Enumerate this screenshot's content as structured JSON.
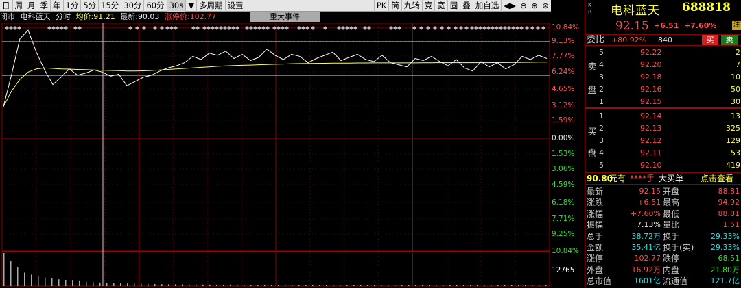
{
  "toolbar": {
    "left_items": [
      "日",
      "周",
      "月",
      "季",
      "年",
      "1分",
      "5分",
      "15分",
      "30分",
      "60分",
      "30s",
      "▼",
      "多周期",
      "设置"
    ],
    "active_index": 10,
    "right_items": [
      "PK",
      "简",
      "九转",
      "竞",
      "宽",
      "固",
      "叠",
      "加自选",
      "◀▶"
    ],
    "win_buttons": [
      "⊖",
      "⊕",
      "⊗"
    ]
  },
  "infobar": {
    "status": "闭市",
    "name": "电科蓝天",
    "mode": "分时",
    "avg_label": "均价:",
    "avg_value": "91.21",
    "last_label": "最新:",
    "last_value": "90.03",
    "limit_label": "涨停价:",
    "limit_value": "102.77",
    "event_button": "重大事件"
  },
  "axis": {
    "upper": [
      "10.84%",
      "9.13%",
      "7.77%",
      "6.24%",
      "4.65%",
      "3.12%",
      "1.59%",
      "0.00%",
      "1.53%",
      "3.06%",
      "4.59%",
      "6.18%",
      "7.71%",
      "9.25%",
      "10.84%"
    ],
    "volume_top": "12765"
  },
  "chart_data": {
    "type": "line",
    "series": [
      {
        "values": [
          3.0,
          6.1,
          9.5,
          10.3,
          8.2,
          6.5,
          5.1,
          5.8,
          6.6,
          6.0,
          6.2,
          6.5,
          6.3,
          5.9,
          6.1,
          5.0,
          5.4,
          5.8,
          6.0,
          6.4,
          6.7,
          6.9,
          7.2,
          7.8,
          7.5,
          8.1,
          7.9,
          8.3,
          7.6,
          8.0,
          7.4,
          7.7,
          8.5,
          7.9,
          7.5,
          8.0,
          7.8,
          7.2,
          7.6,
          7.9,
          8.2,
          7.4,
          7.7,
          8.0,
          7.5,
          7.3,
          7.9,
          7.2,
          7.0,
          6.8,
          7.6,
          7.4,
          7.8,
          7.3,
          6.9,
          7.5,
          6.7,
          6.4,
          7.3,
          6.8,
          7.2,
          6.6,
          7.0,
          7.8,
          7.5,
          7.9,
          7.6
        ]
      },
      {
        "values": [
          3.0,
          4.5,
          5.6,
          6.3,
          6.6,
          6.7,
          6.65,
          6.6,
          6.58,
          6.55,
          6.53,
          6.5,
          6.48,
          6.45,
          6.43,
          6.4,
          6.4,
          6.42,
          6.45,
          6.5,
          6.55,
          6.6,
          6.65,
          6.7,
          6.75,
          6.8,
          6.85,
          6.9,
          6.92,
          6.95,
          6.97,
          7.0,
          7.02,
          7.05,
          7.07,
          7.1,
          7.11,
          7.12,
          7.13,
          7.14,
          7.15,
          7.16,
          7.16,
          7.17,
          7.17,
          7.18,
          7.18,
          7.18,
          7.18,
          7.18,
          7.18,
          7.19,
          7.19,
          7.2,
          7.2,
          7.2,
          7.2,
          7.2,
          7.2,
          7.2,
          7.21,
          7.21,
          7.22,
          7.23,
          7.24,
          7.25,
          7.26
        ]
      }
    ],
    "ylim": [
      -10.84,
      10.84
    ],
    "volume": [
      12765,
      9600,
      7200,
      5200,
      4400,
      3800,
      3300,
      2900,
      2600,
      2300,
      2100,
      1900,
      1700,
      1500,
      1400,
      1300,
      1200,
      1100,
      1000,
      950,
      900,
      850,
      800,
      760,
      720,
      690,
      660,
      640,
      620,
      600,
      590,
      580,
      570,
      560,
      550,
      540,
      530,
      520,
      510,
      500,
      495,
      490,
      485,
      480,
      475,
      470,
      465,
      460,
      455,
      450,
      445,
      440,
      435,
      430,
      425,
      420,
      415,
      410,
      405,
      400,
      395,
      390,
      385,
      380,
      376,
      372,
      368,
      364,
      360,
      356,
      352,
      348,
      344,
      340,
      336,
      332,
      328,
      324,
      320,
      316
    ]
  },
  "quote": {
    "kr": [
      "K",
      "R"
    ],
    "name": "电科蓝天",
    "code": "688818",
    "price": "92.15",
    "change": "+6.51",
    "pct": "+7.60%",
    "badge": "注",
    "weibi_label": "委比",
    "weibi_pct": "+80.92%",
    "weibi_vol": "840",
    "buy_label": "买",
    "sell_label": "卖",
    "sell_side": [
      "卖",
      "盘"
    ],
    "buy_side": [
      "买",
      "盘"
    ],
    "asks": [
      {
        "lvl": "5",
        "price": "92.22",
        "vol": "2"
      },
      {
        "lvl": "4",
        "price": "92.20",
        "vol": "7"
      },
      {
        "lvl": "3",
        "price": "92.18",
        "vol": "10"
      },
      {
        "lvl": "2",
        "price": "92.16",
        "vol": "50"
      },
      {
        "lvl": "1",
        "price": "92.15",
        "vol": "30"
      }
    ],
    "bids": [
      {
        "lvl": "1",
        "price": "92.14",
        "vol": "13"
      },
      {
        "lvl": "2",
        "price": "92.13",
        "vol": "325"
      },
      {
        "lvl": "3",
        "price": "92.12",
        "vol": "129"
      },
      {
        "lvl": "4",
        "price": "92.11",
        "vol": "53"
      },
      {
        "lvl": "5",
        "price": "92.10",
        "vol": "419"
      }
    ],
    "big_order": {
      "price": "90.80",
      "unit": "元有",
      "qty": "****手",
      "tag": "大买单",
      "link": "点击查看"
    },
    "stats": [
      {
        "l1": "最新",
        "v1": "92.15",
        "c1": "c-red",
        "l2": "开盘",
        "v2": "88.81",
        "c2": "c-red"
      },
      {
        "l1": "涨跌",
        "v1": "+6.51",
        "c1": "c-red",
        "l2": "最高",
        "v2": "94.92",
        "c2": "c-red"
      },
      {
        "l1": "涨幅",
        "v1": "+7.60%",
        "c1": "c-red",
        "l2": "最低",
        "v2": "88.81",
        "c2": "c-red"
      },
      {
        "l1": "振幅",
        "v1": "7.13%",
        "c1": "c-wht",
        "l2": "量比",
        "v2": "1.51",
        "c2": "c-red"
      },
      {
        "l1": "总手",
        "v1": "38.72万",
        "c1": "c-cyan",
        "l2": "换手",
        "v2": "29.33%",
        "c2": "c-cyan"
      },
      {
        "l1": "金额",
        "v1": "35.41亿",
        "c1": "c-cyan",
        "l2": "换手(实)",
        "v2": "29.33%",
        "c2": "c-cyan"
      },
      {
        "l1": "涨停",
        "v1": "102.77",
        "c1": "c-red",
        "l2": "跌停",
        "v2": "68.51",
        "c2": "c-grn"
      },
      {
        "l1": "外盘",
        "v1": "16.92万",
        "c1": "c-red",
        "l2": "内盘",
        "v2": "21.80万",
        "c2": "c-grn"
      },
      {
        "l1": "总市值",
        "v1": "1601亿",
        "c1": "c-cyan",
        "l2": "流通值",
        "v2": "121.7亿",
        "c2": "c-cyan"
      }
    ]
  },
  "colors": {
    "price_line": "#ffffff",
    "avg_line": "#ffff66",
    "grid": "#8b0000",
    "volume": "#aaaaaa",
    "up": "#ff4d4d",
    "down": "#33dd33"
  }
}
